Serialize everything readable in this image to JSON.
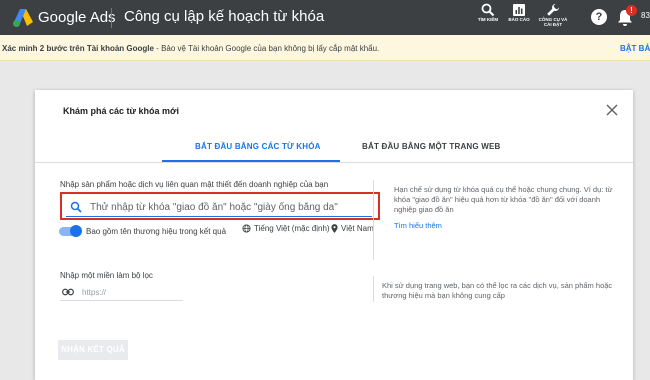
{
  "header": {
    "brand": "Google Ads",
    "tool_title": "Công cụ lập kế hoạch từ khóa",
    "nav": [
      {
        "label": "TÌM KIẾM",
        "icon": "search-icon"
      },
      {
        "label": "BÁO CÁO",
        "icon": "reports-icon"
      },
      {
        "label": "CÔNG CỤ VÀ CÀI ĐẶT",
        "icon": "wrench-icon"
      }
    ],
    "help_glyph": "?",
    "notification_count": "!",
    "account_fragment": "83"
  },
  "banner": {
    "bold_text": "Xác minh 2 bước trên Tài khoản Google",
    "text": " - Bảo vệ Tài khoản Google của bạn không bị lấy cắp mật khẩu.",
    "action": "BẬT BẢO"
  },
  "dialog": {
    "title": "Khám phá các từ khóa mới",
    "tabs": [
      {
        "label": "BẮT ĐẦU BẰNG CÁC TỪ KHÓA",
        "active": true
      },
      {
        "label": "BẮT ĐẦU BẰNG MỘT TRANG WEB",
        "active": false
      }
    ],
    "product_label": "Nhập sản phẩm hoặc dịch vụ liên quan mật thiết đến doanh nghiệp của bạn",
    "search_placeholder": "Thử nhập từ khóa \"giao đồ ăn\" hoặc \"giày ống bằng da\"",
    "toggle_label": "Bao gồm tên thương hiệu trong kết quả",
    "toggle_on": true,
    "language": "Tiếng Việt (mặc định)",
    "location": "Việt Nam",
    "help_text": "Hạn chế sử dụng từ khóa quá cụ thể hoặc chung chung. Ví dụ: từ khóa \"giao đồ ăn\" hiệu quả hơn từ khóa \"đồ ăn\" đối với doanh nghiệp giao đồ ăn",
    "learn_more": "Tìm hiểu thêm",
    "domain_label": "Nhập một miền làm bộ lọc",
    "url_placeholder": "https://",
    "domain_help": "Khi sử dụng trang web, bạn có thể lọc ra các dịch vụ, sản phẩm hoặc thương hiệu mà bạn không cung cấp",
    "get_results": "NHẬN KẾT QUẢ"
  },
  "colors": {
    "accent": "#1a73e8",
    "highlight": "#d93025",
    "topbar": "#3c4043",
    "banner": "#fef7e0"
  }
}
